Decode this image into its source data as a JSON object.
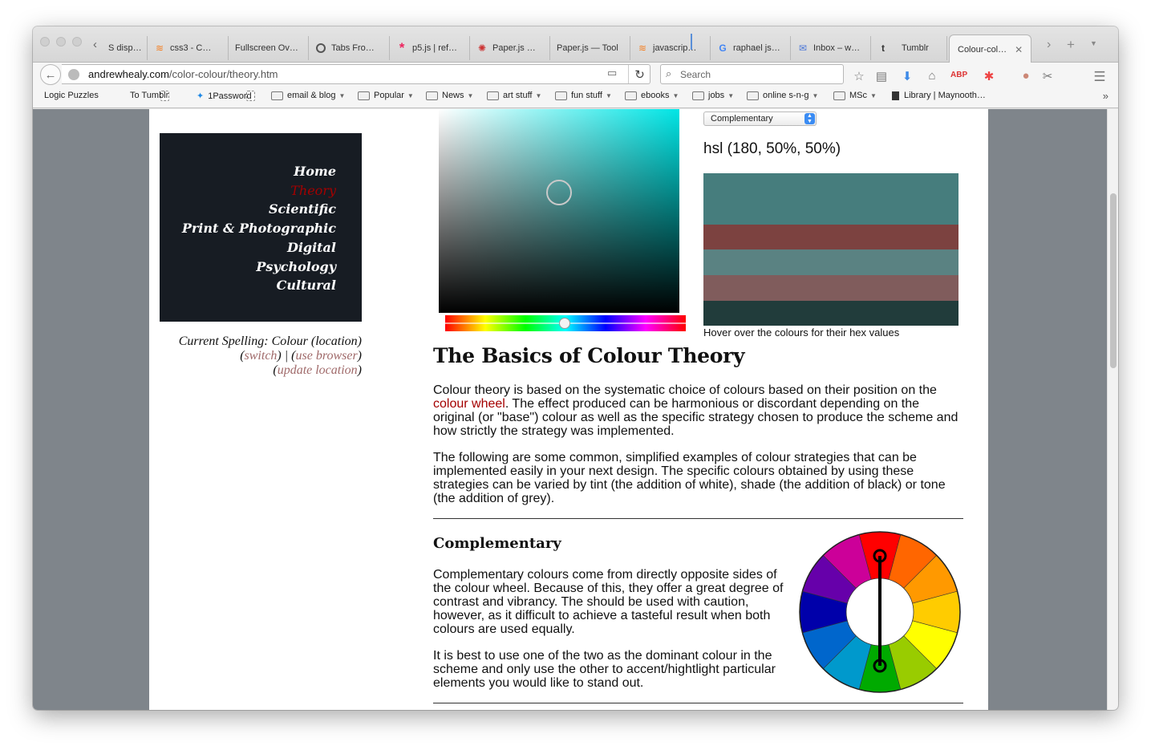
{
  "browser": {
    "tabs": [
      {
        "label": "S disp…",
        "icon": "document-icon"
      },
      {
        "label": "css3 - C…",
        "icon": "stackoverflow-icon"
      },
      {
        "label": "Fullscreen Ov…",
        "icon": "none"
      },
      {
        "label": "Tabs Fro…",
        "icon": "github-icon"
      },
      {
        "label": "p5.js | ref…",
        "icon": "asterisk-icon"
      },
      {
        "label": "Paper.js …",
        "icon": "paperjs-icon"
      },
      {
        "label": "Paper.js — Tool",
        "icon": "none"
      },
      {
        "label": "javascrip…",
        "icon": "stackoverflow-icon"
      },
      {
        "label": "raphael js…",
        "icon": "google-icon"
      },
      {
        "label": "Inbox – w…",
        "icon": "inbox-icon"
      },
      {
        "label": "Tumblr",
        "icon": "tumblr-icon"
      },
      {
        "label": "Colour-col…",
        "icon": "none",
        "active": true
      }
    ],
    "url_domain": "andrewhealy.com",
    "url_path": "/color-colour/theory.htm",
    "search_placeholder": "Search",
    "bookmarks": [
      {
        "label": "Logic Puzzles",
        "type": "page"
      },
      {
        "label": "To Tumblr",
        "type": "page"
      },
      {
        "label": "1Password",
        "type": "dropbox"
      },
      {
        "label": "email & blog",
        "type": "folder"
      },
      {
        "label": "Popular",
        "type": "folder"
      },
      {
        "label": "News",
        "type": "folder"
      },
      {
        "label": "art stuff",
        "type": "folder"
      },
      {
        "label": "fun stuff",
        "type": "folder"
      },
      {
        "label": "ebooks",
        "type": "folder"
      },
      {
        "label": "jobs",
        "type": "folder"
      },
      {
        "label": "online s-n-g",
        "type": "folder"
      },
      {
        "label": "MSc",
        "type": "folder"
      },
      {
        "label": "Library | Maynooth…",
        "type": "library"
      }
    ]
  },
  "site": {
    "nav": [
      "Home",
      "Theory",
      "Scientific",
      "Print & Photographic",
      "Digital",
      "Psychology",
      "Cultural"
    ],
    "current_nav": "Theory",
    "spelling": {
      "line1": "Current Spelling: Colour (location)",
      "switch": "switch",
      "use_browser": "use browser",
      "update_location": "update location"
    }
  },
  "picker": {
    "scheme": "Complementary",
    "hsl_text": "hsl (180, 50%, 50%)",
    "hover_note": "Hover over the colours for their hex values",
    "swatches": [
      "#467d7d",
      "#7c4240",
      "#5a8282",
      "#805c5c",
      "#213c3b"
    ],
    "base_color": "#00e5e5"
  },
  "article": {
    "title": "The Basics of Colour Theory",
    "p1_before": "Colour theory is based on the systematic choice of colours based on their position on the ",
    "p1_link": "colour wheel",
    "p1_after": ". The effect produced can be harmonious or discordant depending on the original (or \"base\") colour as well as the specific strategy chosen to produce the scheme and how strictly the strategy was implemented.",
    "p2": "The following are some common, simplified examples of colour strategies that can be implemented easily in your next design. The specific colours obtained by using these strategies can be varied by tint (the addition of white), shade (the addition of black) or tone (the addition of grey).",
    "section_title": "Complementary",
    "section_p1": "Complementary colours come from directly opposite sides of the colour wheel. Because of this, they offer a great degree of contrast and vibrancy. The should be used with caution, however, as it difficult to achieve a tasteful result when both colours are used equally.",
    "section_p2": "It is best to use one of the two as the dominant colour in the scheme and only use the other to accent/hightlight particular elements you would like to stand out.",
    "wheel_colors": [
      "#ff0000",
      "#ff6600",
      "#ff9900",
      "#ffcc00",
      "#ffff00",
      "#99cc00",
      "#00aa00",
      "#0099cc",
      "#0066cc",
      "#0000aa",
      "#6600aa",
      "#cc0099"
    ]
  }
}
